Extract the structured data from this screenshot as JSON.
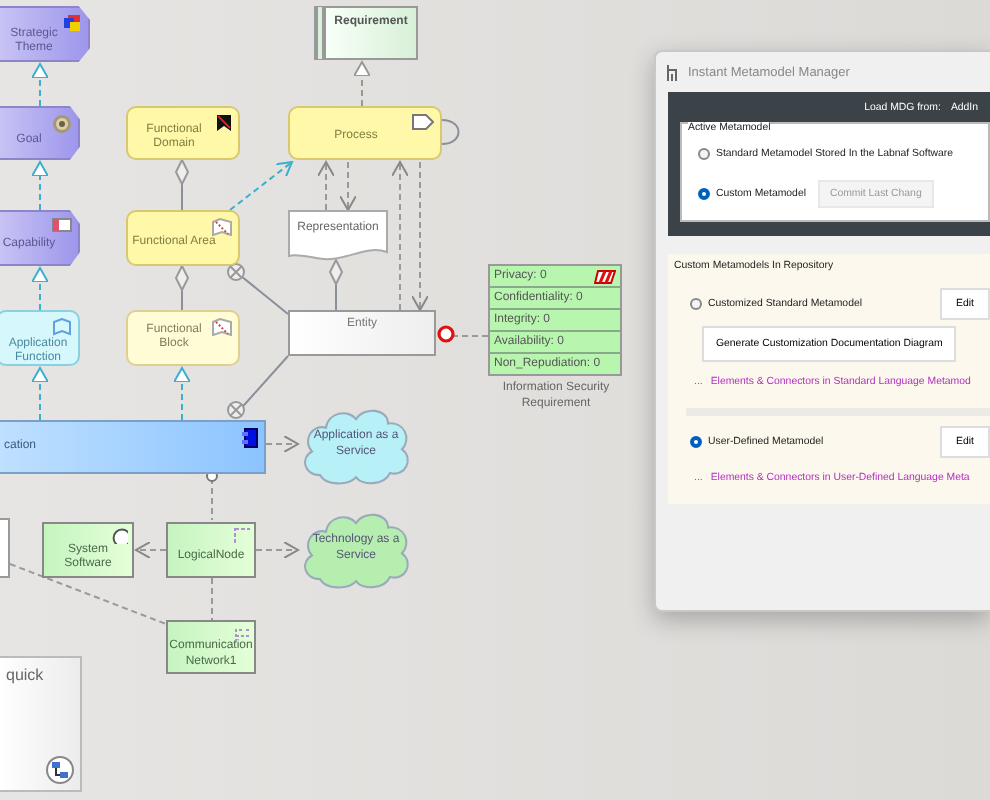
{
  "diagram": {
    "nodes": [
      {
        "kind": "motivation",
        "label": "Strategic Theme"
      },
      {
        "kind": "motivation",
        "label": "Goal"
      },
      {
        "kind": "motivation",
        "label": "Capability"
      },
      {
        "kind": "app-function",
        "label": "Application Function"
      },
      {
        "kind": "app-component",
        "label": "cation"
      },
      {
        "kind": "functional",
        "label": "Functional Domain"
      },
      {
        "kind": "functional",
        "label": "Functional Area"
      },
      {
        "kind": "functional-light",
        "label": "Functional Block"
      },
      {
        "kind": "requirement",
        "label": "Requirement"
      },
      {
        "kind": "functional",
        "label": "Process"
      },
      {
        "kind": "document",
        "label": "Representation"
      },
      {
        "kind": "entity",
        "label": "Entity"
      },
      {
        "kind": "cloud-app",
        "label": "Application as a Service"
      },
      {
        "kind": "stub"
      },
      {
        "kind": "technology",
        "label": "System Software"
      },
      {
        "kind": "technology",
        "label": "LogicalNode"
      },
      {
        "kind": "cloud-tech",
        "label": "Technology as a Service"
      },
      {
        "kind": "technology",
        "label": "Communication Network1"
      },
      {
        "kind": "panel",
        "label": "quick"
      }
    ],
    "security_requirement": {
      "rows": [
        "Privacy: 0",
        "Confidentiality: 0",
        "Integrity: 0",
        "Availability: 0",
        "Non_Repudiation: 0"
      ],
      "caption": "Information Security Requirement"
    }
  },
  "dialog": {
    "title": "Instant Metamodel Manager",
    "load_label": "Load MDG from:",
    "load_source": "AddIn",
    "active_metamodel": {
      "legend": "Active Metamodel",
      "options": [
        {
          "label": "Standard Metamodel Stored In the Labnaf Software",
          "selected": false
        },
        {
          "label": "Custom Metamodel",
          "selected": true
        }
      ],
      "commit_button": {
        "label": "Commit Last Chang",
        "disabled": true
      }
    },
    "repository": {
      "heading": "Custom Metamodels In Repository",
      "options": [
        {
          "label": "Customized Standard Metamodel",
          "selected": false,
          "edit": "Edit",
          "generate": "Generate Customization Documentation Diagram",
          "link_prefix": "...",
          "link": "Elements & Connectors in Standard Language Metamod"
        },
        {
          "label": "User-Defined Metamodel",
          "selected": true,
          "edit": "Edit",
          "link_prefix": "...",
          "link": "Elements & Connectors in User-Defined Language Meta"
        }
      ]
    }
  }
}
